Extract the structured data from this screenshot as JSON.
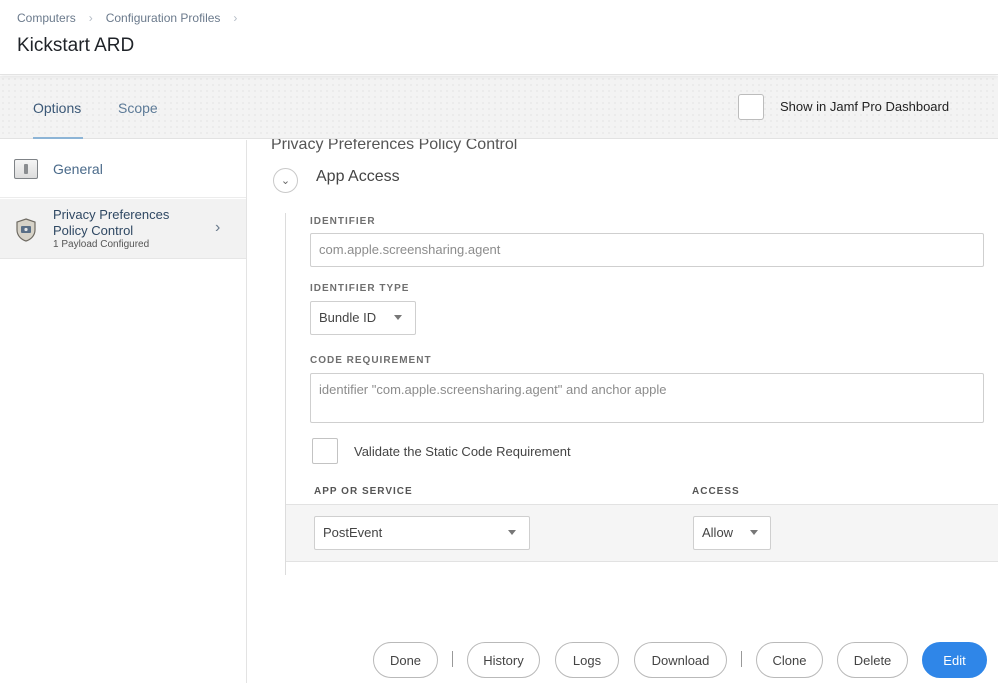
{
  "breadcrumb": {
    "items": [
      "Computers",
      "Configuration Profiles"
    ],
    "separator": "›"
  },
  "page_title": "Kickstart ARD",
  "tabs": [
    {
      "label": "Options",
      "active": true
    },
    {
      "label": "Scope",
      "active": false
    }
  ],
  "dashboard": {
    "label": "Show in Jamf Pro Dashboard",
    "checked": false
  },
  "sidebar": {
    "items": [
      {
        "label": "General",
        "icon": "general-switch-icon"
      },
      {
        "label": "Privacy Preferences Policy Control",
        "sub": "1 Payload Configured",
        "icon": "privacy-shield-icon",
        "selected": true
      }
    ],
    "chevron": "›"
  },
  "main": {
    "section_title": "Privacy Preferences Policy Control",
    "collapse_glyph": "⌄",
    "app_access_title": "App Access",
    "identifier": {
      "label": "IDENTIFIER",
      "value": "com.apple.screensharing.agent"
    },
    "identifier_type": {
      "label": "IDENTIFIER TYPE",
      "value": "Bundle ID"
    },
    "code_requirement": {
      "label": "CODE REQUIREMENT",
      "value": "identifier \"com.apple.screensharing.agent\" and anchor apple"
    },
    "validate": {
      "label": "Validate the Static Code Requirement",
      "checked": false
    },
    "table": {
      "headers": [
        "APP OR SERVICE",
        "ACCESS"
      ],
      "rows": [
        {
          "service": "PostEvent",
          "access": "Allow"
        }
      ]
    }
  },
  "footer": {
    "buttons": [
      "Done",
      "History",
      "Logs",
      "Download",
      "Clone",
      "Delete",
      "Edit"
    ]
  },
  "colors": {
    "accent": "#2f86e8",
    "link": "#5c7a97"
  }
}
